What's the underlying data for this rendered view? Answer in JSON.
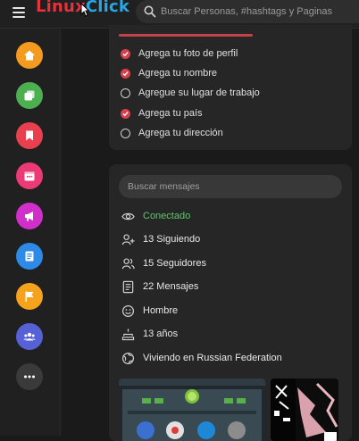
{
  "topbar": {
    "logo_part1": "Linux",
    "logo_part2": "Click",
    "search_placeholder": "Buscar Personas, #hashtags y Paginas"
  },
  "colors": {
    "background": "#1a1a1a",
    "panel": "#262626",
    "accent_red": "#d9404a",
    "online_green": "#5cc86a"
  },
  "sidebar": {
    "items": [
      {
        "icon": "home-icon",
        "color": "#f39a1f"
      },
      {
        "icon": "pages-icon",
        "color": "#4caf50"
      },
      {
        "icon": "bookmark-icon",
        "color": "#e8404f"
      },
      {
        "icon": "calendar-icon",
        "color": "#ec3a77"
      },
      {
        "icon": "megaphone-icon",
        "color": "#d02fc9"
      },
      {
        "icon": "document-icon",
        "color": "#2d8ae6"
      },
      {
        "icon": "flag-icon",
        "color": "#f5a21c"
      },
      {
        "icon": "group-icon",
        "color": "#5661d6"
      },
      {
        "icon": "more-icon",
        "color": "#3a3a3a"
      }
    ]
  },
  "profile_completion": {
    "items": [
      {
        "label": "Agrega tu foto de perfil",
        "done": true
      },
      {
        "label": "Agrega tu nombre",
        "done": true
      },
      {
        "label": "Agregue su lugar de trabajo",
        "done": false
      },
      {
        "label": "Agrega tu país",
        "done": true
      },
      {
        "label": "Agrega tu dirección",
        "done": false
      }
    ]
  },
  "about": {
    "search_placeholder": "Buscar mensajes",
    "status": "Conectado",
    "following": "13 Siguiendo",
    "followers": "15 Seguidores",
    "posts": "22 Mensajes",
    "gender": "Hombre",
    "age": "13 años",
    "location": "Viviendo en Russian Federation"
  }
}
